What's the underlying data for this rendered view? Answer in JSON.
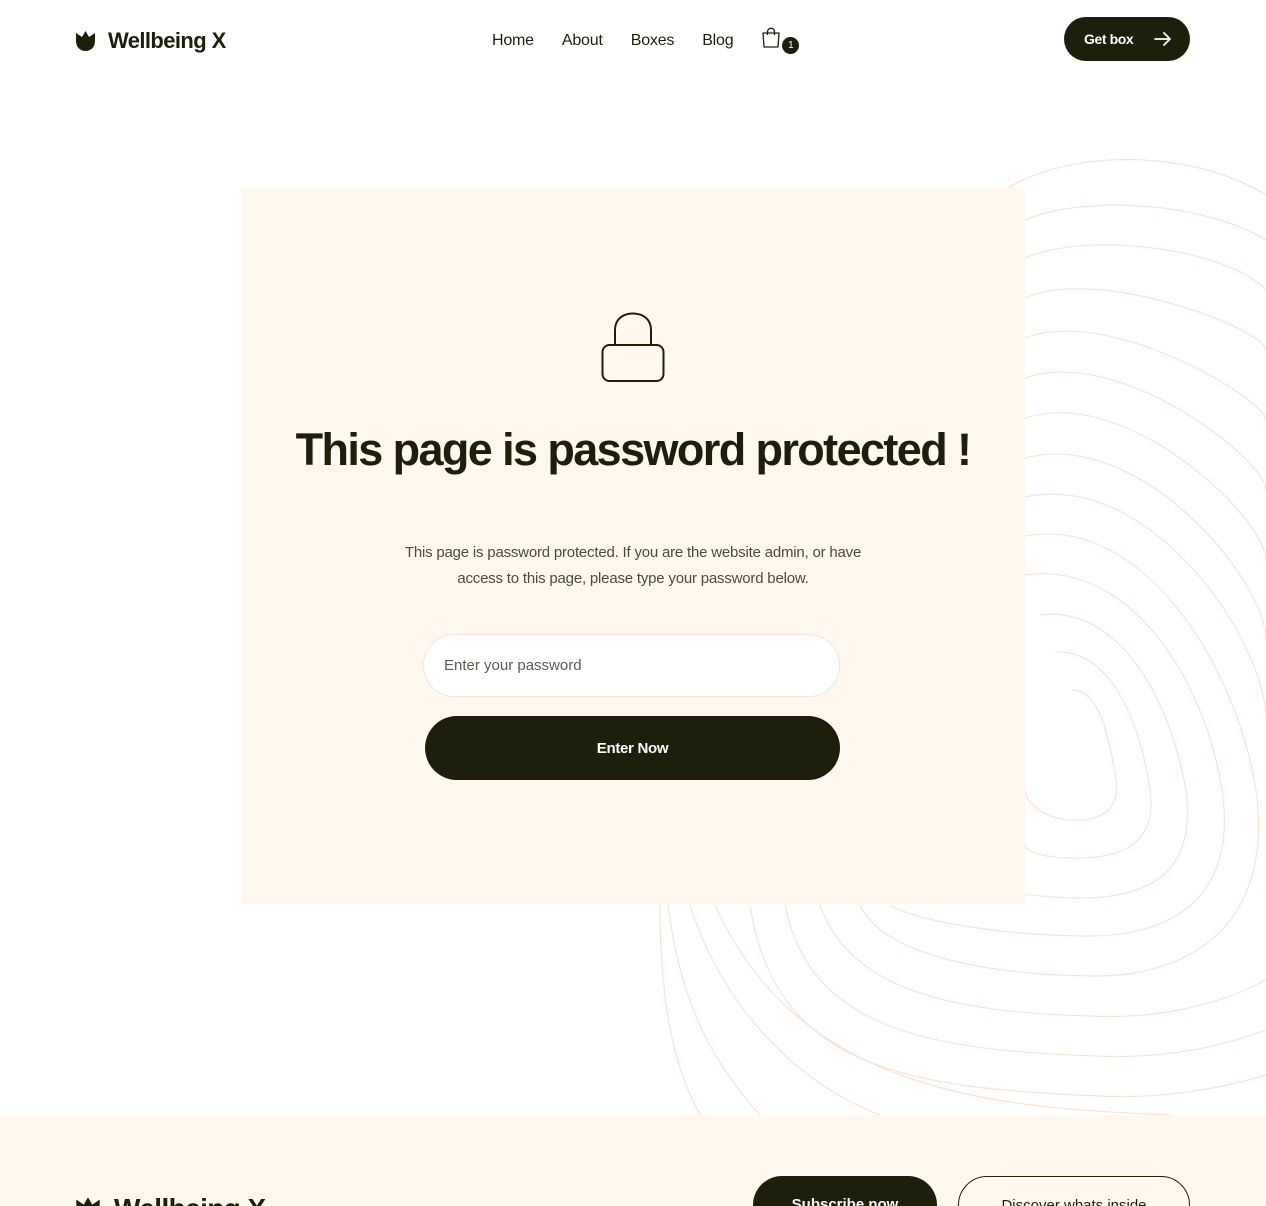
{
  "header": {
    "brand": "Wellbeing X",
    "nav": [
      "Home",
      "About",
      "Boxes",
      "Blog"
    ],
    "cart_count": "1",
    "cta_label": "Get box"
  },
  "main": {
    "title": "This page is password protected !",
    "description": "This page is password protected. If you are the website admin, or have access to this page, please type your password below.",
    "password_placeholder": "Enter your password",
    "submit_label": "Enter Now"
  },
  "footer": {
    "brand": "Wellbeing X",
    "subscribe_label": "Subscribe now",
    "discover_label": "Discover whats inside"
  },
  "colors": {
    "primary": "#1e1f0b",
    "card_background": "#fff8ee",
    "contour_lines": "#f8e4d4"
  },
  "icons": {
    "brand": "tulip-logo-icon",
    "cart": "shopping-bag-icon",
    "cta": "arrow-right-icon",
    "lock": "lock-icon"
  }
}
